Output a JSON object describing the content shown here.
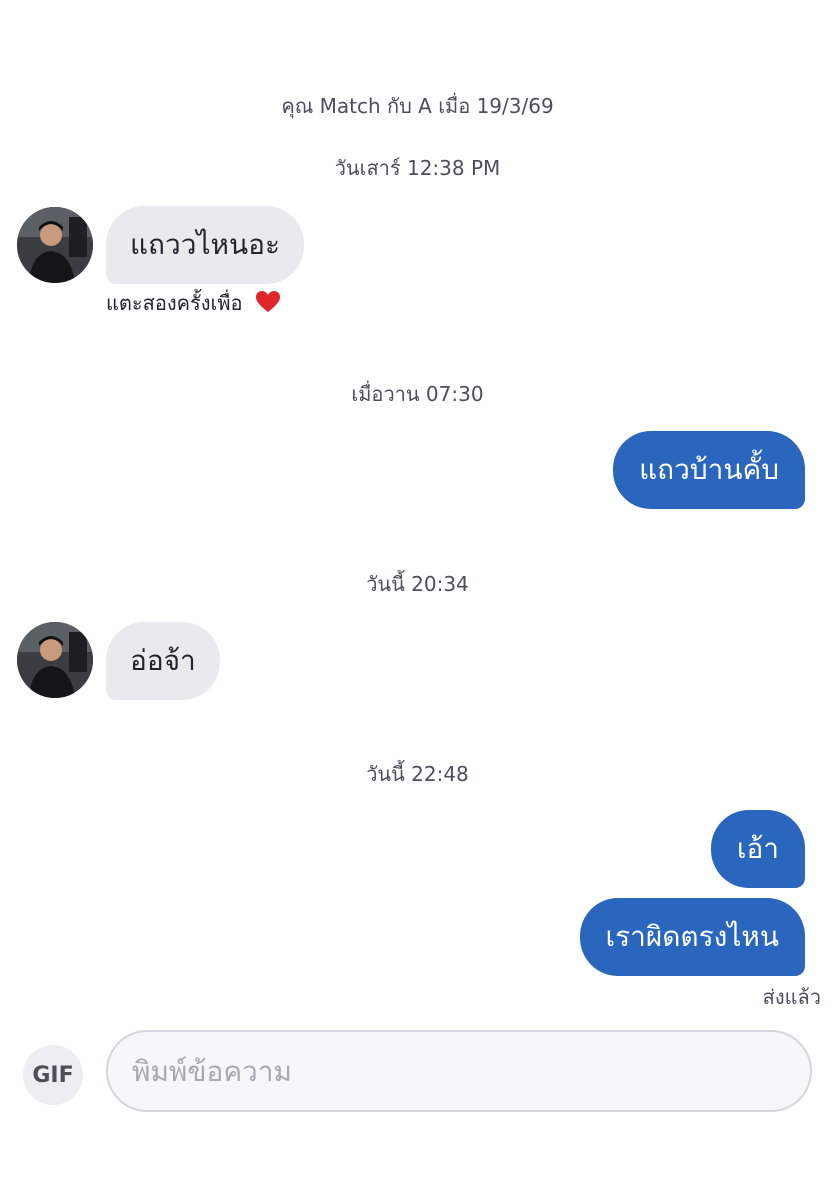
{
  "match_info": "คุณ Match กับ A เมื่อ 19/3/69",
  "groups": [
    {
      "timestamp": "วันเสาร์ 12:38 PM",
      "messages": [
        {
          "direction": "incoming",
          "text": "แถววไหนอะ",
          "hint": "แตะสองครั้งเพื่อ"
        }
      ]
    },
    {
      "timestamp": "เมื่อวาน 07:30",
      "messages": [
        {
          "direction": "outgoing",
          "text": "แถวบ้านคั้บ"
        }
      ]
    },
    {
      "timestamp": "วันนี้ 20:34",
      "messages": [
        {
          "direction": "incoming",
          "text": "อ่อจ้า"
        }
      ]
    },
    {
      "timestamp": "วันนี้ 22:48",
      "messages": [
        {
          "direction": "outgoing",
          "text": "เอ้า"
        },
        {
          "direction": "outgoing",
          "text": "เราผิดตรงไหน",
          "status": "ส่งแล้ว"
        }
      ]
    }
  ],
  "composer": {
    "gif_label": "GIF",
    "placeholder": "พิมพ์ข้อความ"
  },
  "icons": {
    "like_hint": "heart-icon",
    "avatar": "avatar-photo"
  },
  "colors": {
    "outgoing_bubble": "#2a66be",
    "incoming_bubble": "#e9eaee",
    "heart": "#e0262a"
  }
}
